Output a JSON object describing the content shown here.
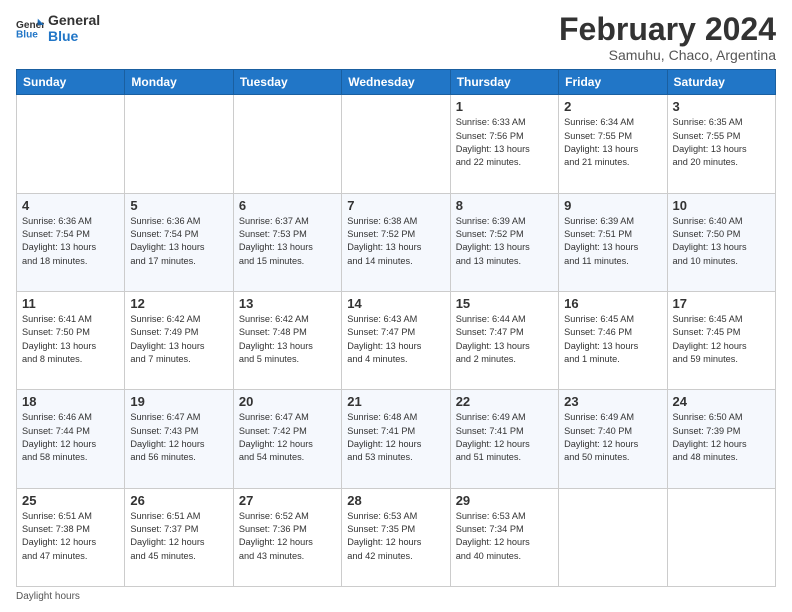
{
  "logo": {
    "line1": "General",
    "line2": "Blue"
  },
  "title": "February 2024",
  "location": "Samuhu, Chaco, Argentina",
  "days_of_week": [
    "Sunday",
    "Monday",
    "Tuesday",
    "Wednesday",
    "Thursday",
    "Friday",
    "Saturday"
  ],
  "weeks": [
    [
      {
        "num": "",
        "info": ""
      },
      {
        "num": "",
        "info": ""
      },
      {
        "num": "",
        "info": ""
      },
      {
        "num": "",
        "info": ""
      },
      {
        "num": "1",
        "info": "Sunrise: 6:33 AM\nSunset: 7:56 PM\nDaylight: 13 hours\nand 22 minutes."
      },
      {
        "num": "2",
        "info": "Sunrise: 6:34 AM\nSunset: 7:55 PM\nDaylight: 13 hours\nand 21 minutes."
      },
      {
        "num": "3",
        "info": "Sunrise: 6:35 AM\nSunset: 7:55 PM\nDaylight: 13 hours\nand 20 minutes."
      }
    ],
    [
      {
        "num": "4",
        "info": "Sunrise: 6:36 AM\nSunset: 7:54 PM\nDaylight: 13 hours\nand 18 minutes."
      },
      {
        "num": "5",
        "info": "Sunrise: 6:36 AM\nSunset: 7:54 PM\nDaylight: 13 hours\nand 17 minutes."
      },
      {
        "num": "6",
        "info": "Sunrise: 6:37 AM\nSunset: 7:53 PM\nDaylight: 13 hours\nand 15 minutes."
      },
      {
        "num": "7",
        "info": "Sunrise: 6:38 AM\nSunset: 7:52 PM\nDaylight: 13 hours\nand 14 minutes."
      },
      {
        "num": "8",
        "info": "Sunrise: 6:39 AM\nSunset: 7:52 PM\nDaylight: 13 hours\nand 13 minutes."
      },
      {
        "num": "9",
        "info": "Sunrise: 6:39 AM\nSunset: 7:51 PM\nDaylight: 13 hours\nand 11 minutes."
      },
      {
        "num": "10",
        "info": "Sunrise: 6:40 AM\nSunset: 7:50 PM\nDaylight: 13 hours\nand 10 minutes."
      }
    ],
    [
      {
        "num": "11",
        "info": "Sunrise: 6:41 AM\nSunset: 7:50 PM\nDaylight: 13 hours\nand 8 minutes."
      },
      {
        "num": "12",
        "info": "Sunrise: 6:42 AM\nSunset: 7:49 PM\nDaylight: 13 hours\nand 7 minutes."
      },
      {
        "num": "13",
        "info": "Sunrise: 6:42 AM\nSunset: 7:48 PM\nDaylight: 13 hours\nand 5 minutes."
      },
      {
        "num": "14",
        "info": "Sunrise: 6:43 AM\nSunset: 7:47 PM\nDaylight: 13 hours\nand 4 minutes."
      },
      {
        "num": "15",
        "info": "Sunrise: 6:44 AM\nSunset: 7:47 PM\nDaylight: 13 hours\nand 2 minutes."
      },
      {
        "num": "16",
        "info": "Sunrise: 6:45 AM\nSunset: 7:46 PM\nDaylight: 13 hours\nand 1 minute."
      },
      {
        "num": "17",
        "info": "Sunrise: 6:45 AM\nSunset: 7:45 PM\nDaylight: 12 hours\nand 59 minutes."
      }
    ],
    [
      {
        "num": "18",
        "info": "Sunrise: 6:46 AM\nSunset: 7:44 PM\nDaylight: 12 hours\nand 58 minutes."
      },
      {
        "num": "19",
        "info": "Sunrise: 6:47 AM\nSunset: 7:43 PM\nDaylight: 12 hours\nand 56 minutes."
      },
      {
        "num": "20",
        "info": "Sunrise: 6:47 AM\nSunset: 7:42 PM\nDaylight: 12 hours\nand 54 minutes."
      },
      {
        "num": "21",
        "info": "Sunrise: 6:48 AM\nSunset: 7:41 PM\nDaylight: 12 hours\nand 53 minutes."
      },
      {
        "num": "22",
        "info": "Sunrise: 6:49 AM\nSunset: 7:41 PM\nDaylight: 12 hours\nand 51 minutes."
      },
      {
        "num": "23",
        "info": "Sunrise: 6:49 AM\nSunset: 7:40 PM\nDaylight: 12 hours\nand 50 minutes."
      },
      {
        "num": "24",
        "info": "Sunrise: 6:50 AM\nSunset: 7:39 PM\nDaylight: 12 hours\nand 48 minutes."
      }
    ],
    [
      {
        "num": "25",
        "info": "Sunrise: 6:51 AM\nSunset: 7:38 PM\nDaylight: 12 hours\nand 47 minutes."
      },
      {
        "num": "26",
        "info": "Sunrise: 6:51 AM\nSunset: 7:37 PM\nDaylight: 12 hours\nand 45 minutes."
      },
      {
        "num": "27",
        "info": "Sunrise: 6:52 AM\nSunset: 7:36 PM\nDaylight: 12 hours\nand 43 minutes."
      },
      {
        "num": "28",
        "info": "Sunrise: 6:53 AM\nSunset: 7:35 PM\nDaylight: 12 hours\nand 42 minutes."
      },
      {
        "num": "29",
        "info": "Sunrise: 6:53 AM\nSunset: 7:34 PM\nDaylight: 12 hours\nand 40 minutes."
      },
      {
        "num": "",
        "info": ""
      },
      {
        "num": "",
        "info": ""
      }
    ]
  ],
  "footer": "Daylight hours"
}
